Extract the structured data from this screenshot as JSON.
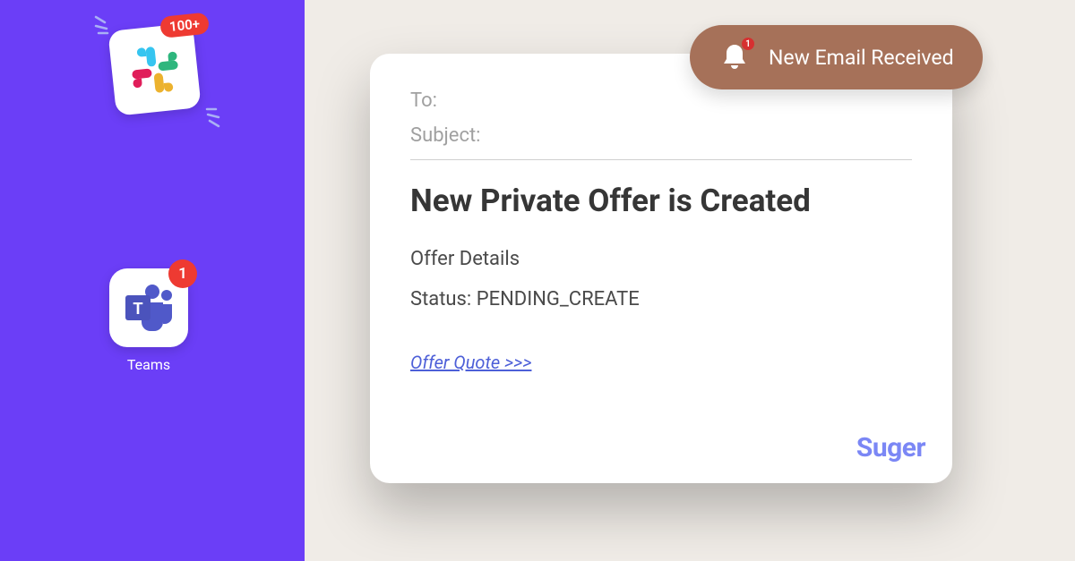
{
  "slack": {
    "badge": "100+"
  },
  "teams": {
    "badge": "1",
    "label": "Teams"
  },
  "notification": {
    "badge": "1",
    "text": "New Email Received"
  },
  "email": {
    "to_label": "To:",
    "subject_label": "Subject:",
    "title": "New Private Offer is Created",
    "section": "Offer Details",
    "status": "Status: PENDING_CREATE",
    "link": "Offer Quote >>>",
    "brand": "Suger"
  }
}
